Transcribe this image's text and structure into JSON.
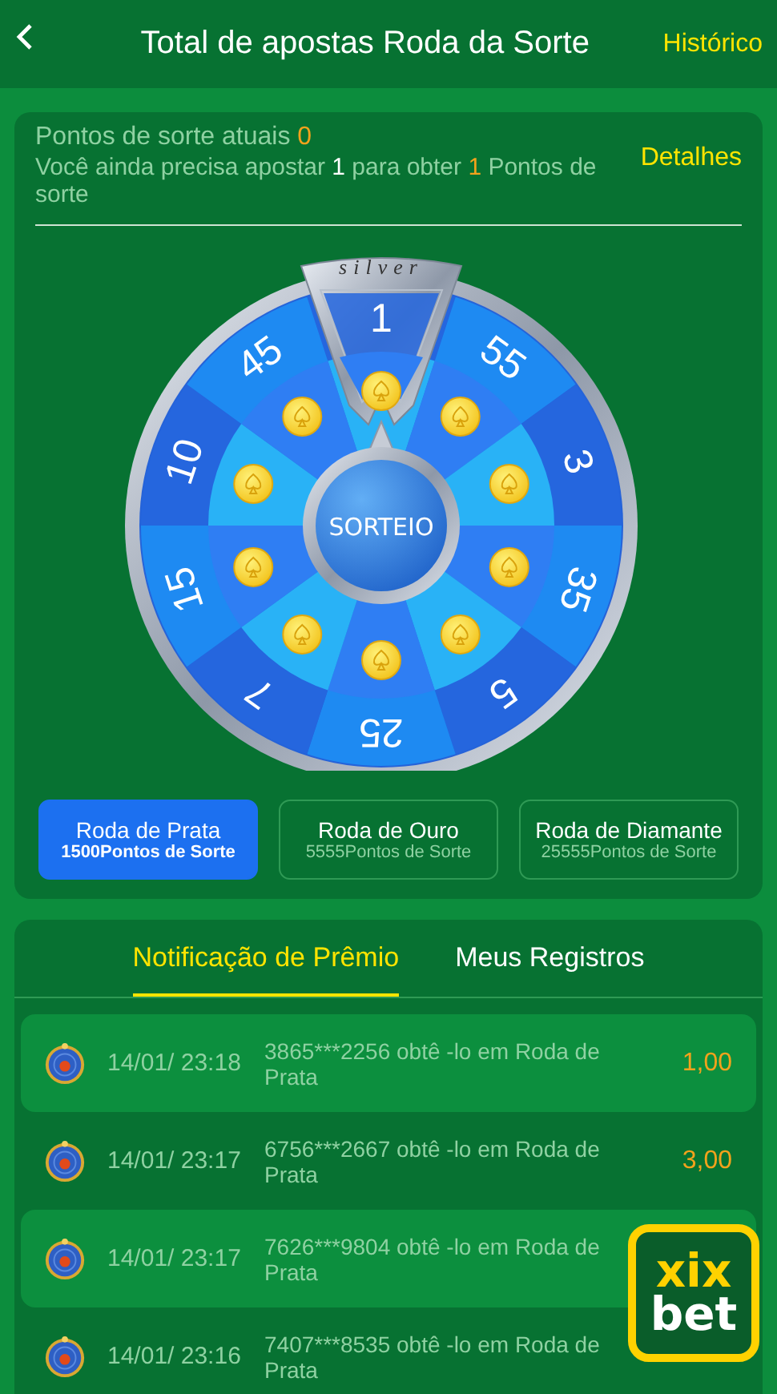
{
  "header": {
    "title": "Total de apostas Roda da Sorte",
    "history_link": "Histórico"
  },
  "info": {
    "points_label": "Pontos de sorte atuais",
    "points_value": "0",
    "need_before": "Você ainda precisa apostar",
    "need_bet": "1",
    "need_middle": "para obter",
    "need_points": "1",
    "need_after": "Pontos de sorte",
    "details_link": "Detalhes"
  },
  "wheel": {
    "badge": "silver",
    "center_button": "SORTEIO",
    "segments": [
      {
        "value": "1"
      },
      {
        "value": "55"
      },
      {
        "value": "3"
      },
      {
        "value": "35"
      },
      {
        "value": "5"
      },
      {
        "value": "25"
      },
      {
        "value": "7"
      },
      {
        "value": "15"
      },
      {
        "value": "10"
      },
      {
        "value": "45"
      }
    ]
  },
  "tiers": [
    {
      "name": "Roda de Prata",
      "points": "1500Pontos de Sorte",
      "selected": true
    },
    {
      "name": "Roda de Ouro",
      "points": "5555Pontos de Sorte",
      "selected": false
    },
    {
      "name": "Roda de Diamante",
      "points": "25555Pontos de Sorte",
      "selected": false
    }
  ],
  "tabs": [
    {
      "label": "Notificação de Prêmio",
      "selected": true
    },
    {
      "label": "Meus Registros",
      "selected": false
    }
  ],
  "records": [
    {
      "time": "14/01/ 23:18",
      "text": "3865***2256 obtê -lo em Roda de Prata",
      "amount": "1,00"
    },
    {
      "time": "14/01/ 23:17",
      "text": "6756***2667 obtê -lo em Roda de Prata",
      "amount": "3,00"
    },
    {
      "time": "14/01/ 23:17",
      "text": "7626***9804 obtê -lo em Roda de Prata"
    },
    {
      "time": "14/01/ 23:16",
      "text": "7407***8535 obtê -lo em Roda de Prata"
    }
  ],
  "floating_logo": {
    "top": "xix",
    "bottom": "bet"
  }
}
